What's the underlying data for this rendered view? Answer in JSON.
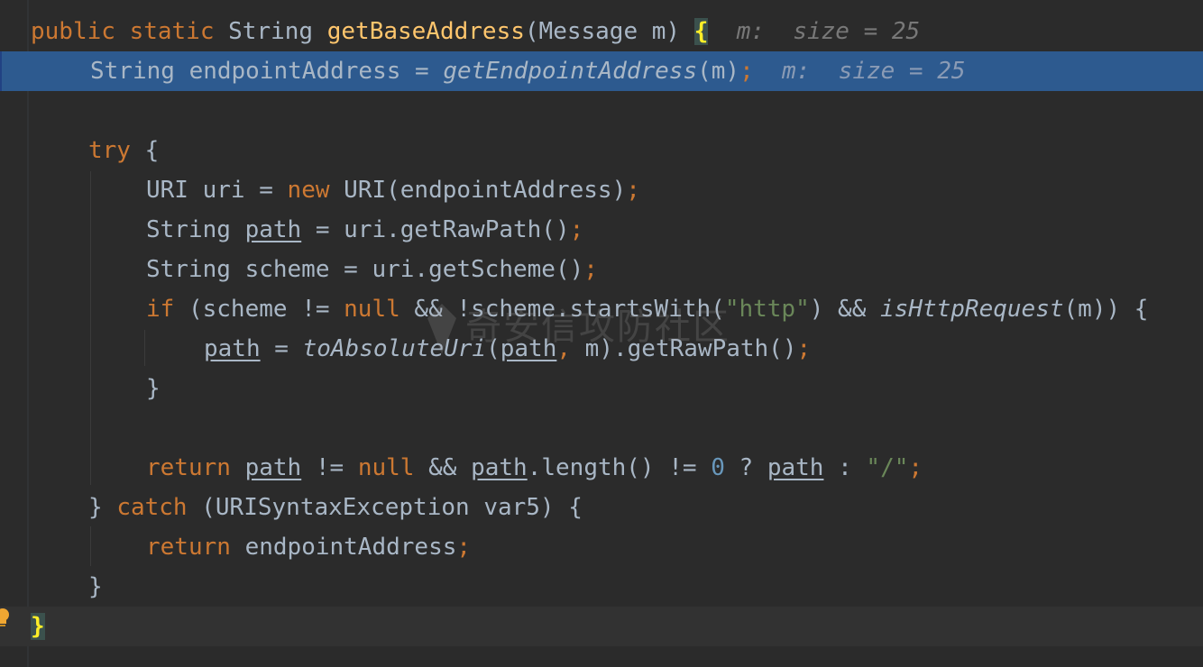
{
  "editor": {
    "lines": [
      {
        "code_a": "public static",
        "type": "String",
        "fn": "getBaseAddress",
        "params": "(Message m)",
        "brace": "{",
        "hint": "m:  size = 25"
      },
      {
        "indent": "    ",
        "code_a": "String endpointAddress = ",
        "call": "getEndpointAddress",
        "args": "(m)",
        "semi": ";",
        "hint": "m:  size = 25"
      },
      {
        "try_kw": "try",
        "rest": " {"
      },
      {
        "a": "URI uri = ",
        "new_kw": "new",
        "b": " URI(endpointAddress)",
        "semi": ";"
      },
      {
        "a": "String ",
        "path": "path",
        "b": " = uri.getRawPath()",
        "semi": ";"
      },
      {
        "a": "String scheme = uri.getScheme()",
        "semi": ";"
      },
      {
        "if_kw": "if",
        "a": " (scheme != ",
        "null_kw": "null",
        "b": " && !scheme.startsWith(",
        "str": "\"http\"",
        "c": ") && ",
        "call": "isHttpRequest",
        "d": "(m)) {"
      },
      {
        "path1": "path",
        "a": " = ",
        "call": "toAbsoluteUri",
        "b": "(",
        "path2": "path",
        "comma": ",",
        "c": " m).getRawPath()",
        "semi": ";"
      },
      {
        "close": "}"
      },
      {
        "ret_kw": "return",
        "sp1": " ",
        "path1": "path",
        "a": " != ",
        "null_kw": "null",
        "b": " && ",
        "path2": "path",
        "c": ".length() != ",
        "num": "0",
        "d": " ? ",
        "path3": "path",
        "e": " : ",
        "str": "\"/\"",
        "semi": ";"
      },
      {
        "a": "} ",
        "catch_kw": "catch",
        "b": " (URISyntaxException var5) {"
      },
      {
        "ret_kw": "return",
        "a": " endpointAddress",
        "semi": ";"
      },
      {
        "close": "}"
      },
      {
        "close": "}"
      }
    ],
    "watermark": "奇安信攻防社区"
  },
  "colors": {
    "background": "#2b2b2b",
    "keyword": "#cc7832",
    "function": "#ffc66d",
    "string": "#6a8759",
    "number": "#6897bb",
    "selection": "#2d5a8f"
  },
  "icons": {
    "bulb": "lightbulb-icon"
  }
}
